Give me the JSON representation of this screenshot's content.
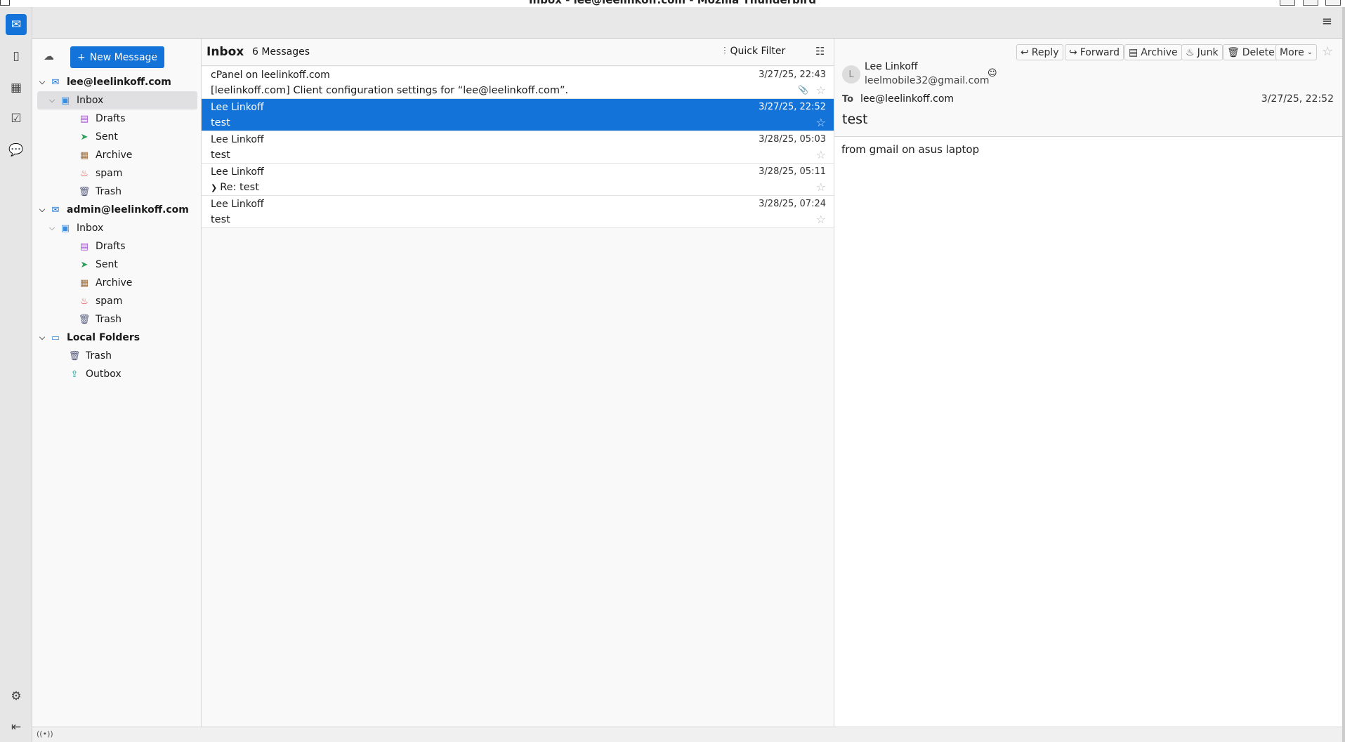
{
  "window": {
    "title": "Inbox - lee@leelinkoff.com - Mozilla Thunderbird"
  },
  "spaces": [
    {
      "name": "mail",
      "active": true
    },
    {
      "name": "address-book"
    },
    {
      "name": "calendar"
    },
    {
      "name": "tasks"
    },
    {
      "name": "chat"
    }
  ],
  "folder_pane": {
    "new_message_label": "New Message",
    "more_label": "···",
    "folders": [
      {
        "label": "lee@leelinkoff.com",
        "type": "account",
        "level": 0
      },
      {
        "label": "Inbox",
        "type": "inbox",
        "level": 1,
        "selected": true
      },
      {
        "label": "Drafts",
        "type": "drafts",
        "level": 2
      },
      {
        "label": "Sent",
        "type": "sent",
        "level": 2
      },
      {
        "label": "Archive",
        "type": "archive",
        "level": 2
      },
      {
        "label": "spam",
        "type": "spam",
        "level": 2
      },
      {
        "label": "Trash",
        "type": "trash",
        "level": 2
      },
      {
        "label": "admin@leelinkoff.com",
        "type": "account",
        "level": 0
      },
      {
        "label": "Inbox",
        "type": "inbox",
        "level": 1
      },
      {
        "label": "Drafts",
        "type": "drafts",
        "level": 2
      },
      {
        "label": "Sent",
        "type": "sent",
        "level": 2
      },
      {
        "label": "Archive",
        "type": "archive",
        "level": 2
      },
      {
        "label": "spam",
        "type": "spam",
        "level": 2
      },
      {
        "label": "Trash",
        "type": "trash",
        "level": 2
      },
      {
        "label": "Local Folders",
        "type": "local",
        "level": 0
      },
      {
        "label": "Trash",
        "type": "trash",
        "level": 1
      },
      {
        "label": "Outbox",
        "type": "outbox",
        "level": 1
      }
    ]
  },
  "message_list": {
    "folder_name": "Inbox",
    "count_label": "6 Messages",
    "quick_filter_label": "Quick Filter",
    "messages": [
      {
        "from": "cPanel on leelinkoff.com",
        "subject": "[leelinkoff.com] Client configuration settings for “lee@leelinkoff.com”.",
        "date": "3/27/25, 22:43",
        "attachment": true
      },
      {
        "from": "Lee Linkoff",
        "subject": "test",
        "date": "3/27/25, 22:52",
        "selected": true
      },
      {
        "from": "Lee Linkoff",
        "subject": "test",
        "date": "3/28/25, 05:03"
      },
      {
        "from": "Lee Linkoff",
        "subject": "Re: test",
        "date": "3/28/25, 05:11",
        "thread": true
      },
      {
        "from": "Lee Linkoff",
        "subject": "test",
        "date": "3/28/25, 07:24"
      }
    ]
  },
  "reader": {
    "buttons": {
      "reply": "Reply",
      "forward": "Forward",
      "archive": "Archive",
      "junk": "Junk",
      "delete": "Delete",
      "more": "More"
    },
    "avatar_letter": "L",
    "from_name": "Lee Linkoff",
    "from_email": "leelmobile32@gmail.com",
    "to_label": "To",
    "to": "lee@leelinkoff.com",
    "date": "3/27/25, 22:52",
    "subject": "test",
    "body": "from gmail on asus laptop"
  },
  "colors": {
    "accent": "#1373d9"
  }
}
